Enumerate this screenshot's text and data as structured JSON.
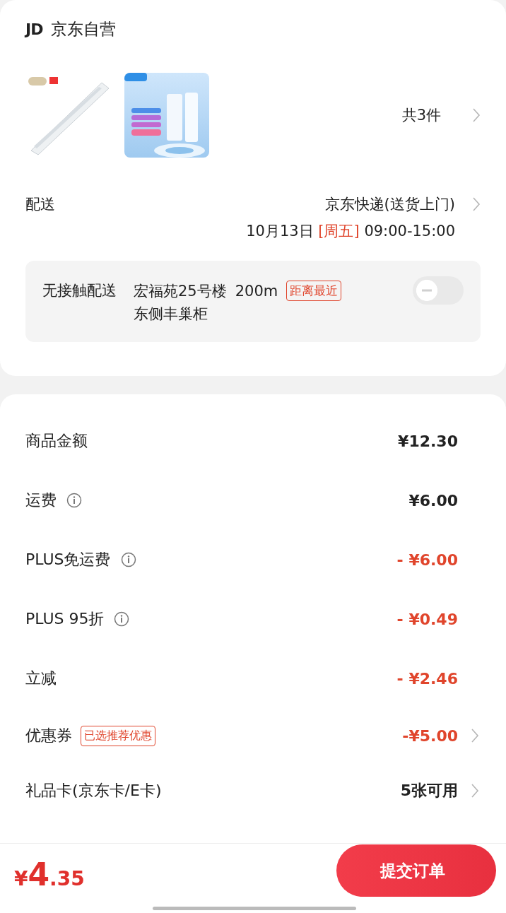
{
  "shop": {
    "logo": "JD",
    "name": "京东自营"
  },
  "products": {
    "count": "共3件"
  },
  "delivery": {
    "label": "配送",
    "method": "京东快递(送货上门)",
    "date": "10月13日",
    "weekday": "[周五]",
    "time": "09:00-15:00"
  },
  "contactless": {
    "label": "无接触配送",
    "place": "宏福苑25号楼",
    "distance": "200m",
    "tag": "距离最近",
    "place_line2": "东侧丰巢柜",
    "on": false
  },
  "summary": [
    {
      "label": "商品金额",
      "info": false,
      "value": "¥12.30",
      "discount": false,
      "arrow": false
    },
    {
      "label": "运费",
      "info": true,
      "value": "¥6.00",
      "discount": false,
      "arrow": false
    },
    {
      "label": "PLUS免运费",
      "info": true,
      "value": "- ¥6.00",
      "discount": true,
      "arrow": false
    },
    {
      "label": "PLUS 95折",
      "info": true,
      "value": "- ¥0.49",
      "discount": true,
      "arrow": false
    },
    {
      "label": "立减",
      "info": false,
      "value": "- ¥2.46",
      "discount": true,
      "arrow": false
    },
    {
      "label": "优惠券",
      "info": false,
      "tag": "已选推荐优惠",
      "value": "-¥5.00",
      "discount": true,
      "arrow": true
    },
    {
      "label": "礼品卡(京东卡/E卡)",
      "info": false,
      "value": "5张可用",
      "discount": false,
      "arrow": true
    }
  ],
  "footer": {
    "currency": "¥",
    "integer": "4",
    "decimal": ".35",
    "button": "提交订单"
  }
}
